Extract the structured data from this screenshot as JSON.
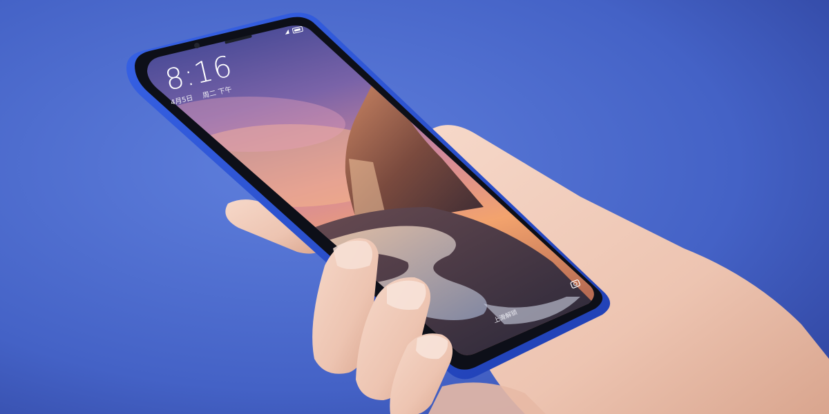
{
  "scene": {
    "description_type": "product-photo",
    "colors": {
      "background_light": "#5b79d6",
      "background_dark": "#2e3f95",
      "phone_frame": "#2a4fd0",
      "skin": "#f0cbbb",
      "sky_top": "#3b3f8a",
      "sky_mid": "#c77aa2",
      "sky_glow": "#f2a06c"
    }
  },
  "lockscreen": {
    "time": "8:16",
    "date": "4月5日",
    "weekday": "周二 下午",
    "unlock_hint": "上滑解锁",
    "icons": {
      "status": "signal-battery-icon",
      "camera": "camera-icon"
    }
  }
}
